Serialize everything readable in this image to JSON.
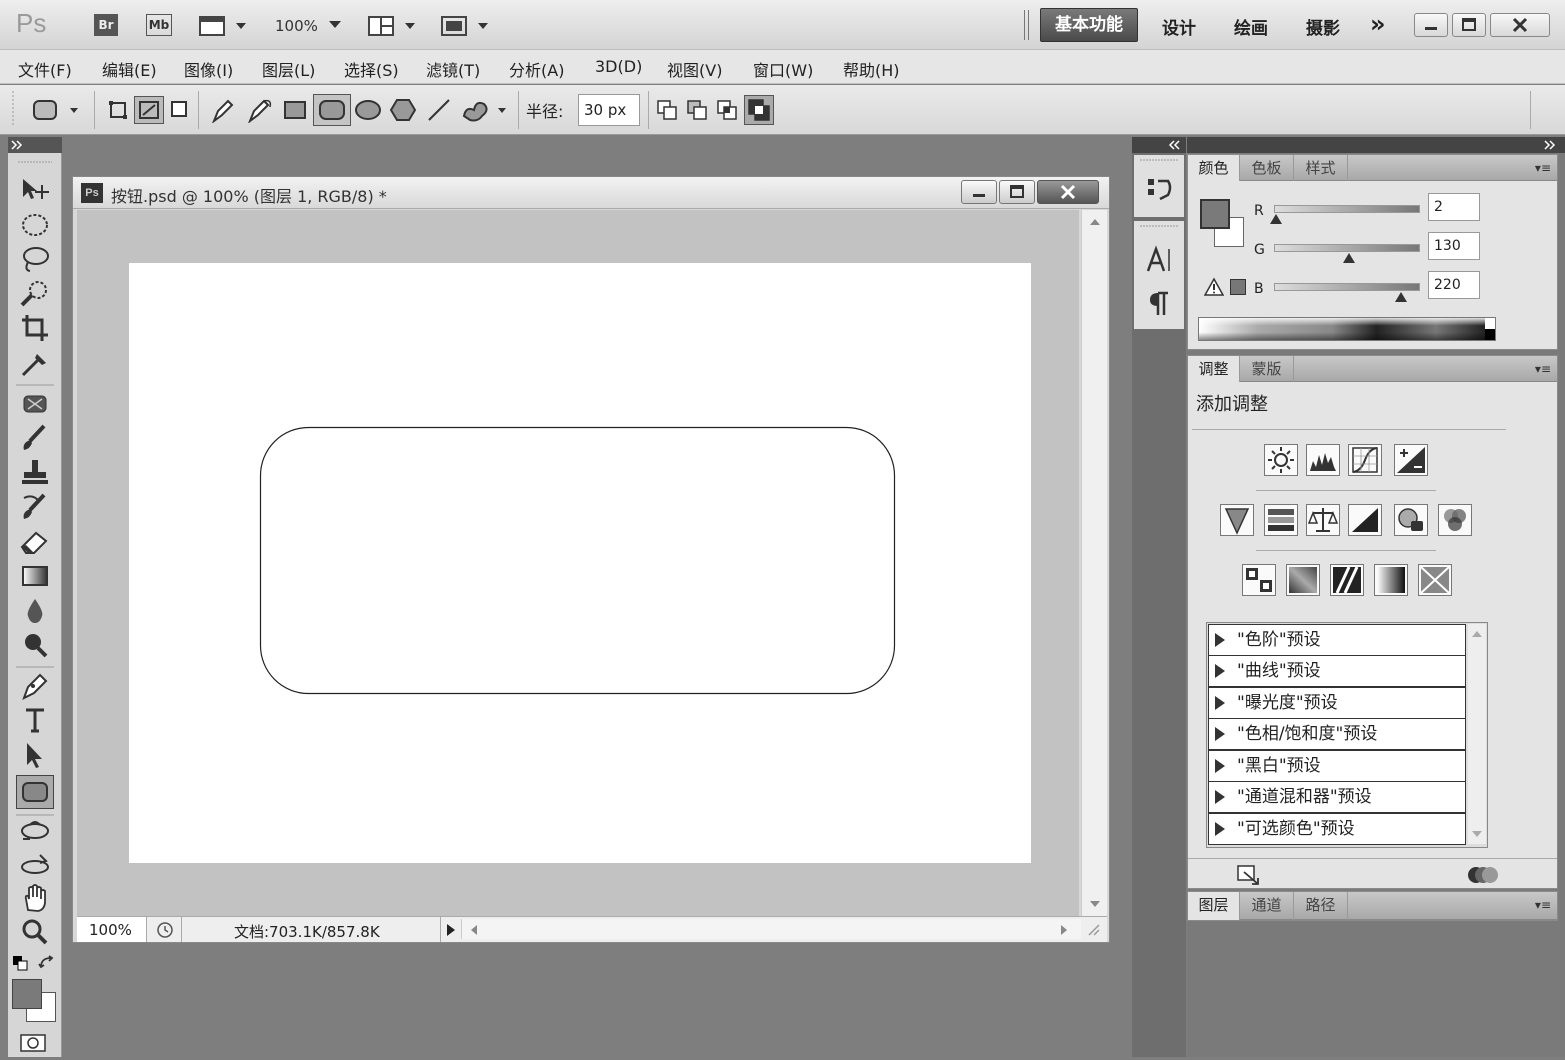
{
  "app": {
    "logo": "Ps"
  },
  "topbar": {
    "bridge_label": "Br",
    "minibridge_label": "Mb",
    "zoom": "100%",
    "workspaces": {
      "active": "基本功能",
      "items": [
        "设计",
        "绘画",
        "摄影"
      ],
      "more": "»"
    }
  },
  "menus": [
    "文件(F)",
    "编辑(E)",
    "图像(I)",
    "图层(L)",
    "选择(S)",
    "滤镜(T)",
    "分析(A)",
    "3D(D)",
    "视图(V)",
    "窗口(W)",
    "帮助(H)"
  ],
  "options": {
    "radius_label": "半径:",
    "radius_value": "30 px"
  },
  "document": {
    "icon": "Ps",
    "title": "按钮.psd @ 100% (图层 1, RGB/8) *",
    "zoom": "100%",
    "doc_info": "文档:703.1K/857.8K"
  },
  "color_panel": {
    "tabs": [
      "颜色",
      "色板",
      "样式"
    ],
    "menu_icon": "▾≡",
    "labels": {
      "r": "R",
      "g": "G",
      "b": "B"
    },
    "r": "2",
    "g": "130",
    "b": "220",
    "r_level": 0.01,
    "g_level": 0.51,
    "b_level": 0.86
  },
  "adjust_panel": {
    "tabs": [
      "调整",
      "蒙版"
    ],
    "menu_icon": "▾≡",
    "heading": "添加调整",
    "presets": [
      "\"色阶\"预设",
      "\"曲线\"预设",
      "\"曝光度\"预设",
      "\"色相/饱和度\"预设",
      "\"黑白\"预设",
      "\"通道混和器\"预设",
      "\"可选颜色\"预设"
    ]
  },
  "layers_panel": {
    "tabs": [
      "图层",
      "通道",
      "路径"
    ],
    "menu_icon": "▾≡"
  },
  "colors": {
    "accent_dark": "#4a4a4a",
    "foreground_swatch": "#7a7a7a",
    "background_swatch": "#ffffff"
  }
}
